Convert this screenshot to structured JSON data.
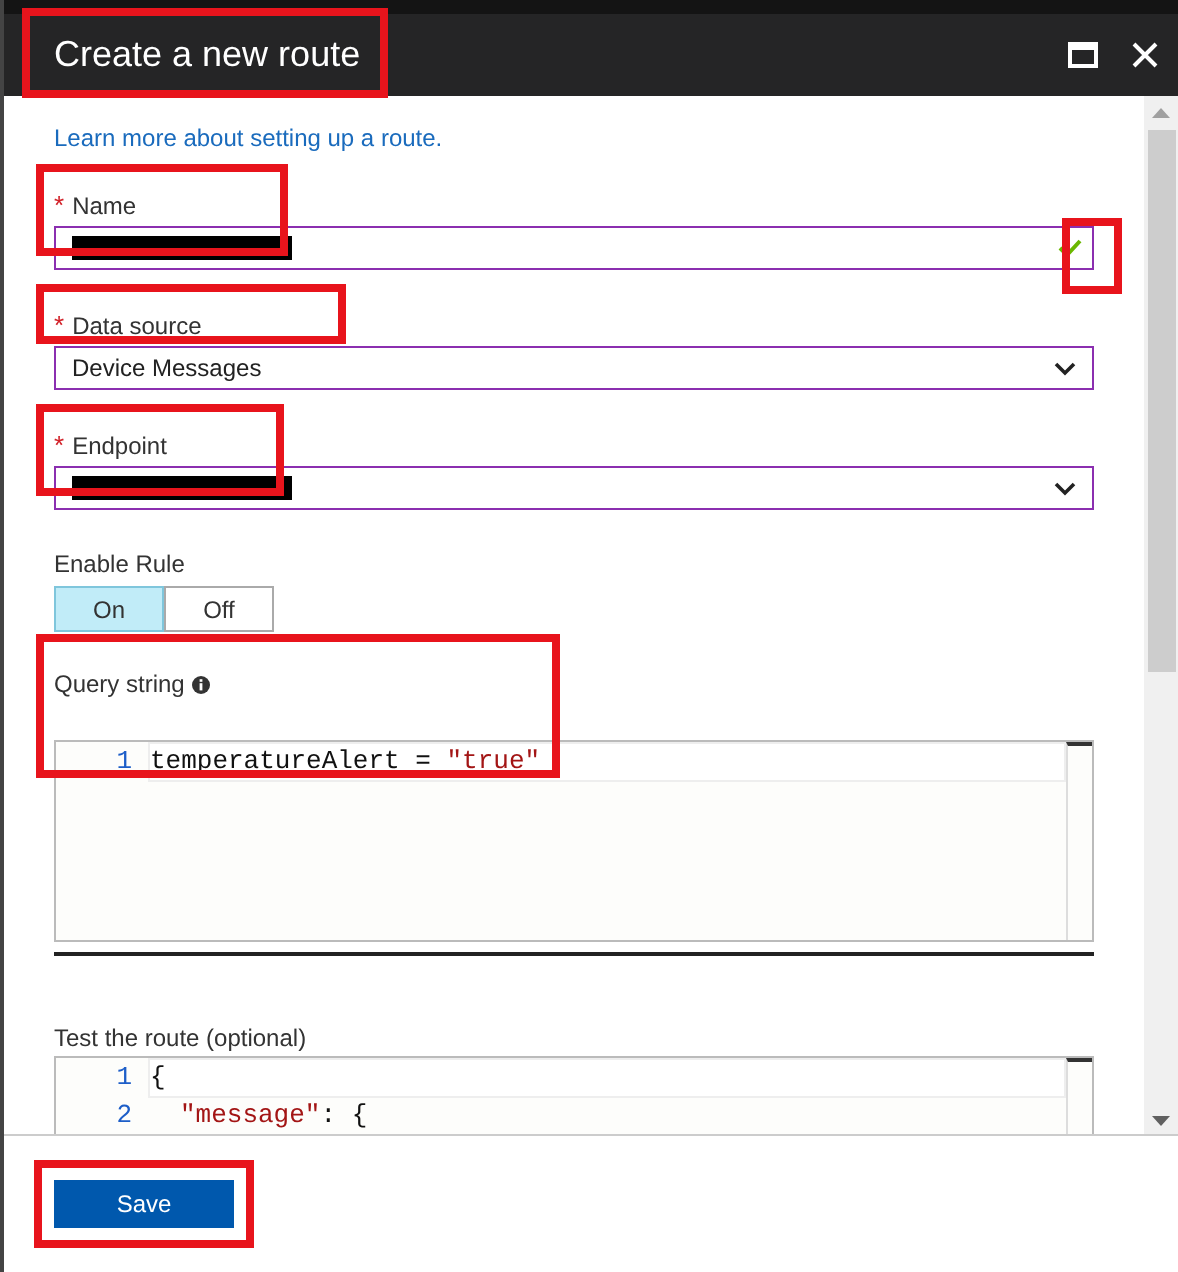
{
  "window": {
    "title": "Create a new route",
    "title_highlighted": true
  },
  "link": "Learn more about setting up a route.",
  "fields": [
    {
      "kind": "text",
      "label": "Name",
      "required_mark": "*",
      "redacted": true,
      "valid": true,
      "highlighted": true,
      "check_highlighted": true
    },
    {
      "kind": "select",
      "label": "Data source",
      "required_mark": "*",
      "value": "Device Messages",
      "highlighted": true
    },
    {
      "kind": "select",
      "label": "Endpoint",
      "required_mark": "*",
      "redacted": true,
      "highlighted": true
    }
  ],
  "enable_rule": {
    "label": "Enable Rule",
    "options": [
      {
        "label": "On",
        "selected": true
      },
      {
        "label": "Off",
        "selected": false
      }
    ]
  },
  "query": {
    "label": "Query string",
    "highlighted": true,
    "lines": [
      {
        "number": "1",
        "tokens": [
          {
            "kind": "plain",
            "text": "temperatureAlert = "
          },
          {
            "kind": "string",
            "text": "\"true\""
          }
        ]
      }
    ]
  },
  "test": {
    "label": "Test the route (optional)",
    "lines": [
      {
        "number": "1",
        "indent": false,
        "tokens": [
          {
            "kind": "plain",
            "text": "{"
          }
        ]
      },
      {
        "number": "2",
        "indent": true,
        "tokens": [
          {
            "kind": "string",
            "text": "\"message\""
          },
          {
            "kind": "plain",
            "text": ": {"
          }
        ]
      }
    ]
  },
  "footer": {
    "save": "Save",
    "save_highlighted": true
  }
}
